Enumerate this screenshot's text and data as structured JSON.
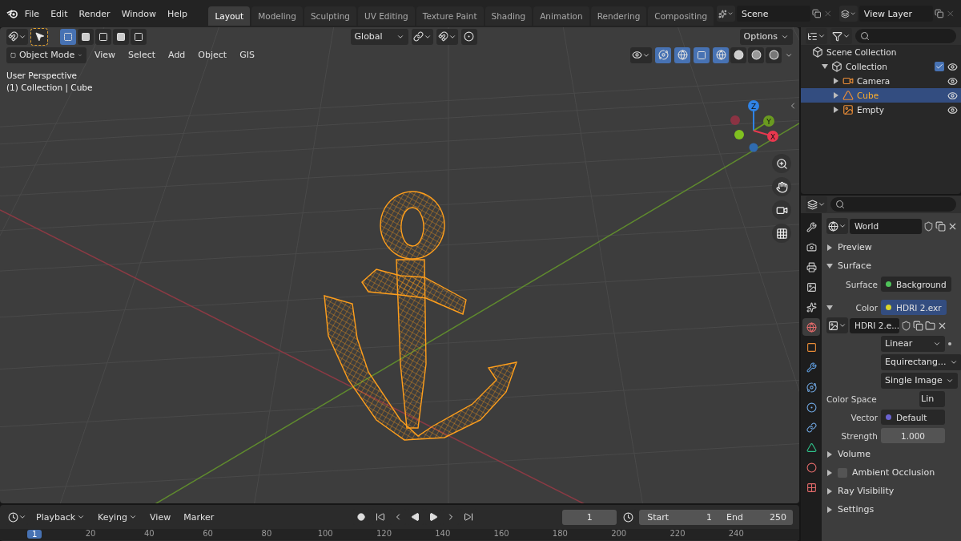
{
  "menu": {
    "items": [
      "File",
      "Edit",
      "Render",
      "Window",
      "Help"
    ]
  },
  "workspaces": [
    {
      "label": "Layout",
      "selected": true
    },
    {
      "label": "Modeling",
      "selected": false
    },
    {
      "label": "Sculpting",
      "selected": false
    },
    {
      "label": "UV Editing",
      "selected": false
    },
    {
      "label": "Texture Paint",
      "selected": false
    },
    {
      "label": "Shading",
      "selected": false
    },
    {
      "label": "Animation",
      "selected": false
    },
    {
      "label": "Rendering",
      "selected": false
    },
    {
      "label": "Compositing",
      "selected": false
    }
  ],
  "scene": {
    "name": "Scene"
  },
  "view_layer": {
    "name": "View Layer"
  },
  "viewport": {
    "select_modes": [
      {
        "selected": true
      },
      {
        "selected": false
      },
      {
        "selected": false
      },
      {
        "selected": false
      },
      {
        "selected": false
      }
    ],
    "transform_orientation": "Global",
    "options": "Options",
    "mode": "Object Mode",
    "menus": [
      "View",
      "Select",
      "Add",
      "Object",
      "GIS"
    ],
    "shading": [
      {
        "selected": true
      },
      {
        "selected": false
      },
      {
        "selected": false
      },
      {
        "selected": false
      }
    ],
    "overlay_lines": [
      "User Perspective",
      "(1) Collection | Cube"
    ],
    "axes": [
      {
        "label": "Z",
        "color": "#2f83e6"
      },
      {
        "label": "Y",
        "color": "#6a9a20"
      },
      {
        "label": "X",
        "color": "#e8384f"
      }
    ]
  },
  "outliner": {
    "root": "Scene Collection",
    "tree": [
      {
        "label": "Collection",
        "expanded": true,
        "checked": true,
        "children": [
          {
            "label": "Camera",
            "kind": "camera",
            "selected": false
          },
          {
            "label": "Cube",
            "kind": "mesh",
            "selected": true
          },
          {
            "label": "Empty",
            "kind": "image",
            "selected": false
          }
        ]
      }
    ]
  },
  "properties": {
    "tabs": [
      {
        "kind": "tool",
        "selected": false
      },
      {
        "kind": "render",
        "selected": false
      },
      {
        "kind": "output",
        "selected": false
      },
      {
        "kind": "view_layer",
        "selected": false
      },
      {
        "kind": "scene",
        "selected": false
      },
      {
        "kind": "world",
        "selected": true
      },
      {
        "kind": "object",
        "selected": false
      },
      {
        "kind": "modifiers",
        "selected": false
      },
      {
        "kind": "particles",
        "selected": false
      },
      {
        "kind": "physics",
        "selected": false
      },
      {
        "kind": "constraints",
        "selected": false
      },
      {
        "kind": "data",
        "selected": false
      },
      {
        "kind": "material",
        "selected": false
      },
      {
        "kind": "texture",
        "selected": false
      }
    ],
    "world": "World",
    "panels_before": [
      {
        "label": "Preview",
        "expanded": false
      },
      {
        "label": "Surface",
        "expanded": true
      }
    ],
    "surface": {
      "label": "Surface",
      "value": "Background",
      "color": "#4fc35a"
    },
    "color": {
      "label": "Color",
      "value": "HDRI 2.exr",
      "color": "#d8d42a",
      "expanded": true
    },
    "image": "HDRI 2.e...",
    "dropdowns": [
      "Linear",
      "Equirectang...",
      "Single Image"
    ],
    "color_space": {
      "label": "Color Space",
      "value": "Lin"
    },
    "vector": {
      "label": "Vector",
      "value": "Default",
      "color": "#6a62d0"
    },
    "strength": {
      "label": "Strength",
      "value": "1.000"
    },
    "panels_after": [
      {
        "label": "Volume",
        "expanded": false,
        "kind": "plain"
      },
      {
        "label": "Ambient Occlusion",
        "expanded": false,
        "kind": "checkbox",
        "checked": false
      },
      {
        "label": "Ray Visibility",
        "expanded": false,
        "kind": "plain"
      },
      {
        "label": "Settings",
        "expanded": false,
        "kind": "plain"
      }
    ]
  },
  "timeline": {
    "menus": [
      "Playback",
      "Keying",
      "View",
      "Marker"
    ],
    "current_frame": "1",
    "start_label": "Start",
    "start": "1",
    "end_label": "End",
    "end": "250",
    "playhead": "1",
    "ticks": [
      "20",
      "40",
      "60",
      "80",
      "100",
      "120",
      "140",
      "160",
      "180",
      "200",
      "220",
      "240"
    ]
  }
}
